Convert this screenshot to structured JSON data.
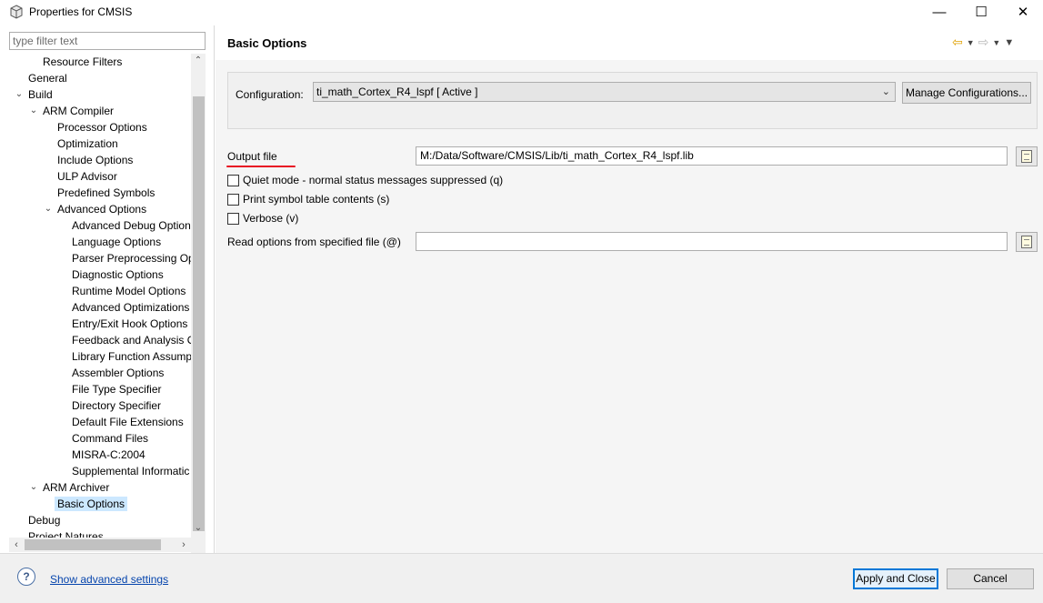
{
  "window": {
    "title": "Properties for CMSIS",
    "minimize_glyph": "—",
    "maximize_glyph": "☐",
    "close_glyph": "✕"
  },
  "filter": {
    "placeholder": "type filter text",
    "value": ""
  },
  "tree": [
    {
      "label": "Resource Filters",
      "level": 2,
      "twisty": ""
    },
    {
      "label": "General",
      "level": 1,
      "twisty": ""
    },
    {
      "label": "Build",
      "level": 1,
      "twisty": "expanded"
    },
    {
      "label": "ARM Compiler",
      "level": 2,
      "twisty": "expanded"
    },
    {
      "label": "Processor Options",
      "level": 3,
      "twisty": ""
    },
    {
      "label": "Optimization",
      "level": 3,
      "twisty": ""
    },
    {
      "label": "Include Options",
      "level": 3,
      "twisty": ""
    },
    {
      "label": "ULP Advisor",
      "level": 3,
      "twisty": ""
    },
    {
      "label": "Predefined Symbols",
      "level": 3,
      "twisty": ""
    },
    {
      "label": "Advanced Options",
      "level": 3,
      "twisty": "expanded"
    },
    {
      "label": "Advanced Debug Option",
      "level": 4,
      "twisty": ""
    },
    {
      "label": "Language Options",
      "level": 4,
      "twisty": ""
    },
    {
      "label": "Parser Preprocessing Opt",
      "level": 4,
      "twisty": ""
    },
    {
      "label": "Diagnostic Options",
      "level": 4,
      "twisty": ""
    },
    {
      "label": "Runtime Model Options",
      "level": 4,
      "twisty": ""
    },
    {
      "label": "Advanced Optimizations",
      "level": 4,
      "twisty": ""
    },
    {
      "label": "Entry/Exit Hook Options",
      "level": 4,
      "twisty": ""
    },
    {
      "label": "Feedback and Analysis O",
      "level": 4,
      "twisty": ""
    },
    {
      "label": "Library Function Assump",
      "level": 4,
      "twisty": ""
    },
    {
      "label": "Assembler Options",
      "level": 4,
      "twisty": ""
    },
    {
      "label": "File Type Specifier",
      "level": 4,
      "twisty": ""
    },
    {
      "label": "Directory Specifier",
      "level": 4,
      "twisty": ""
    },
    {
      "label": "Default File Extensions",
      "level": 4,
      "twisty": ""
    },
    {
      "label": "Command Files",
      "level": 4,
      "twisty": ""
    },
    {
      "label": "MISRA-C:2004",
      "level": 4,
      "twisty": ""
    },
    {
      "label": "Supplemental Informatic",
      "level": 4,
      "twisty": ""
    },
    {
      "label": "ARM Archiver",
      "level": 2,
      "twisty": "expanded"
    },
    {
      "label": "Basic Options",
      "level": 3,
      "twisty": "",
      "selected": true
    },
    {
      "label": "Debug",
      "level": 1,
      "twisty": ""
    },
    {
      "label": "Project Natures",
      "level": 1,
      "twisty": ""
    }
  ],
  "page": {
    "title": "Basic Options",
    "nav_icons": [
      "back-arrow-icon",
      "forward-arrow-icon",
      "view-menu-icon"
    ]
  },
  "configuration": {
    "label": "Configuration:",
    "selected": "ti_math_Cortex_R4_lspf  [ Active ]",
    "manage_label": "Manage Configurations..."
  },
  "output_file": {
    "label": "Output file",
    "value": "M:/Data/Software/CMSIS/Lib/ti_math_Cortex_R4_lspf.lib"
  },
  "options": [
    {
      "label": "Quiet mode - normal status messages suppressed (q)",
      "checked": false
    },
    {
      "label": "Print symbol table contents (s)",
      "checked": false
    },
    {
      "label": "Verbose (v)",
      "checked": false
    }
  ],
  "read_options": {
    "label": "Read options from specified file (@)",
    "value": ""
  },
  "footer": {
    "help_glyph": "?",
    "advanced_link": "Show advanced settings",
    "apply_label": "Apply and Close",
    "cancel_label": "Cancel"
  },
  "colors": {
    "accent": "#0078d7",
    "selection": "#cce8ff",
    "link": "#0645ad",
    "annotation_underline": "#e81123"
  }
}
